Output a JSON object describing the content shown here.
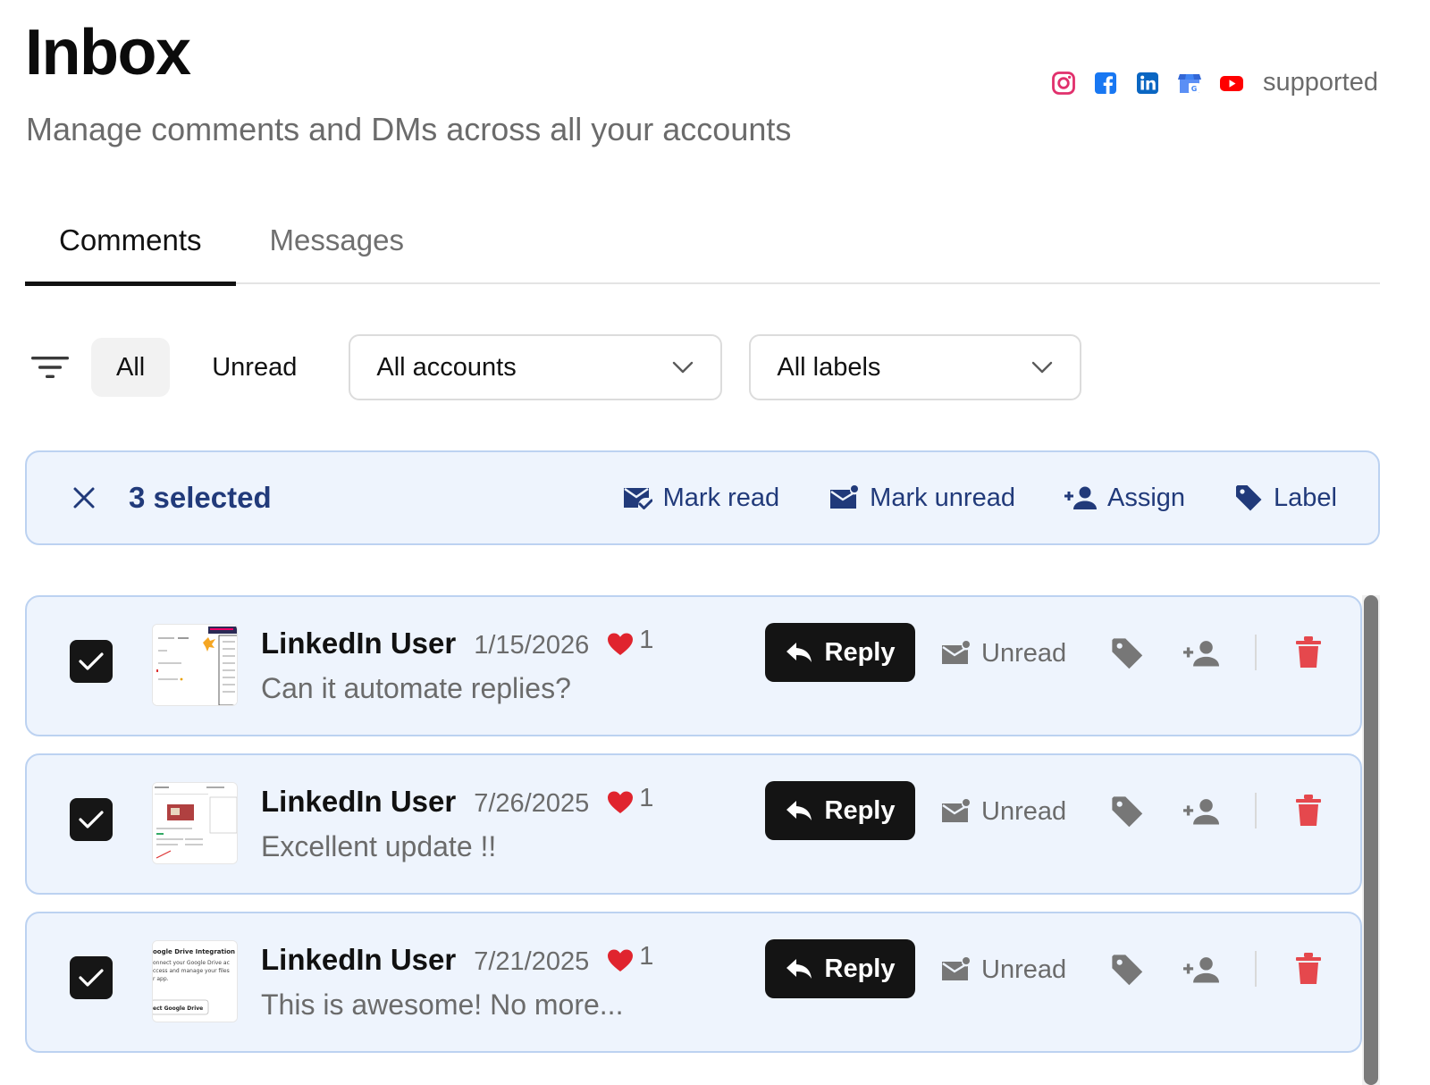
{
  "header": {
    "title": "Inbox",
    "subtitle": "Manage comments and DMs across all your accounts",
    "supported_label": "supported",
    "platforms": [
      "instagram-icon",
      "facebook-icon",
      "linkedin-icon",
      "google-business-icon",
      "youtube-icon"
    ]
  },
  "tabs": [
    {
      "label": "Comments",
      "active": true
    },
    {
      "label": "Messages",
      "active": false
    }
  ],
  "filters": {
    "all_label": "All",
    "unread_label": "Unread",
    "accounts_value": "All accounts",
    "labels_value": "All labels"
  },
  "bulk": {
    "count_label": "3 selected",
    "mark_read": "Mark read",
    "mark_unread": "Mark unread",
    "assign": "Assign",
    "label": "Label",
    "accent_color": "#213a7a"
  },
  "comments": [
    {
      "author": "LinkedIn User",
      "date": "1/15/2026",
      "likes": "1",
      "text": "Can it automate replies?",
      "reply_label": "Reply",
      "unread_label": "Unread",
      "checked": true
    },
    {
      "author": "LinkedIn User",
      "date": "7/26/2025",
      "likes": "1",
      "text": "Excellent update !!",
      "reply_label": "Reply",
      "unread_label": "Unread",
      "checked": true
    },
    {
      "author": "LinkedIn User",
      "date": "7/21/2025",
      "likes": "1",
      "text": "This is awesome! No more...",
      "reply_label": "Reply",
      "unread_label": "Unread",
      "checked": true
    }
  ],
  "thumb3": {
    "heading": "oogle Drive Integration",
    "line1": "onnect your Google Drive ac",
    "line2": "ccess and manage your files",
    "line3": "r app.",
    "button": "ect Google Drive"
  },
  "colors": {
    "danger": "#e5484d",
    "selected_bg": "#eef4fd",
    "selected_border": "#bcd2f1"
  }
}
